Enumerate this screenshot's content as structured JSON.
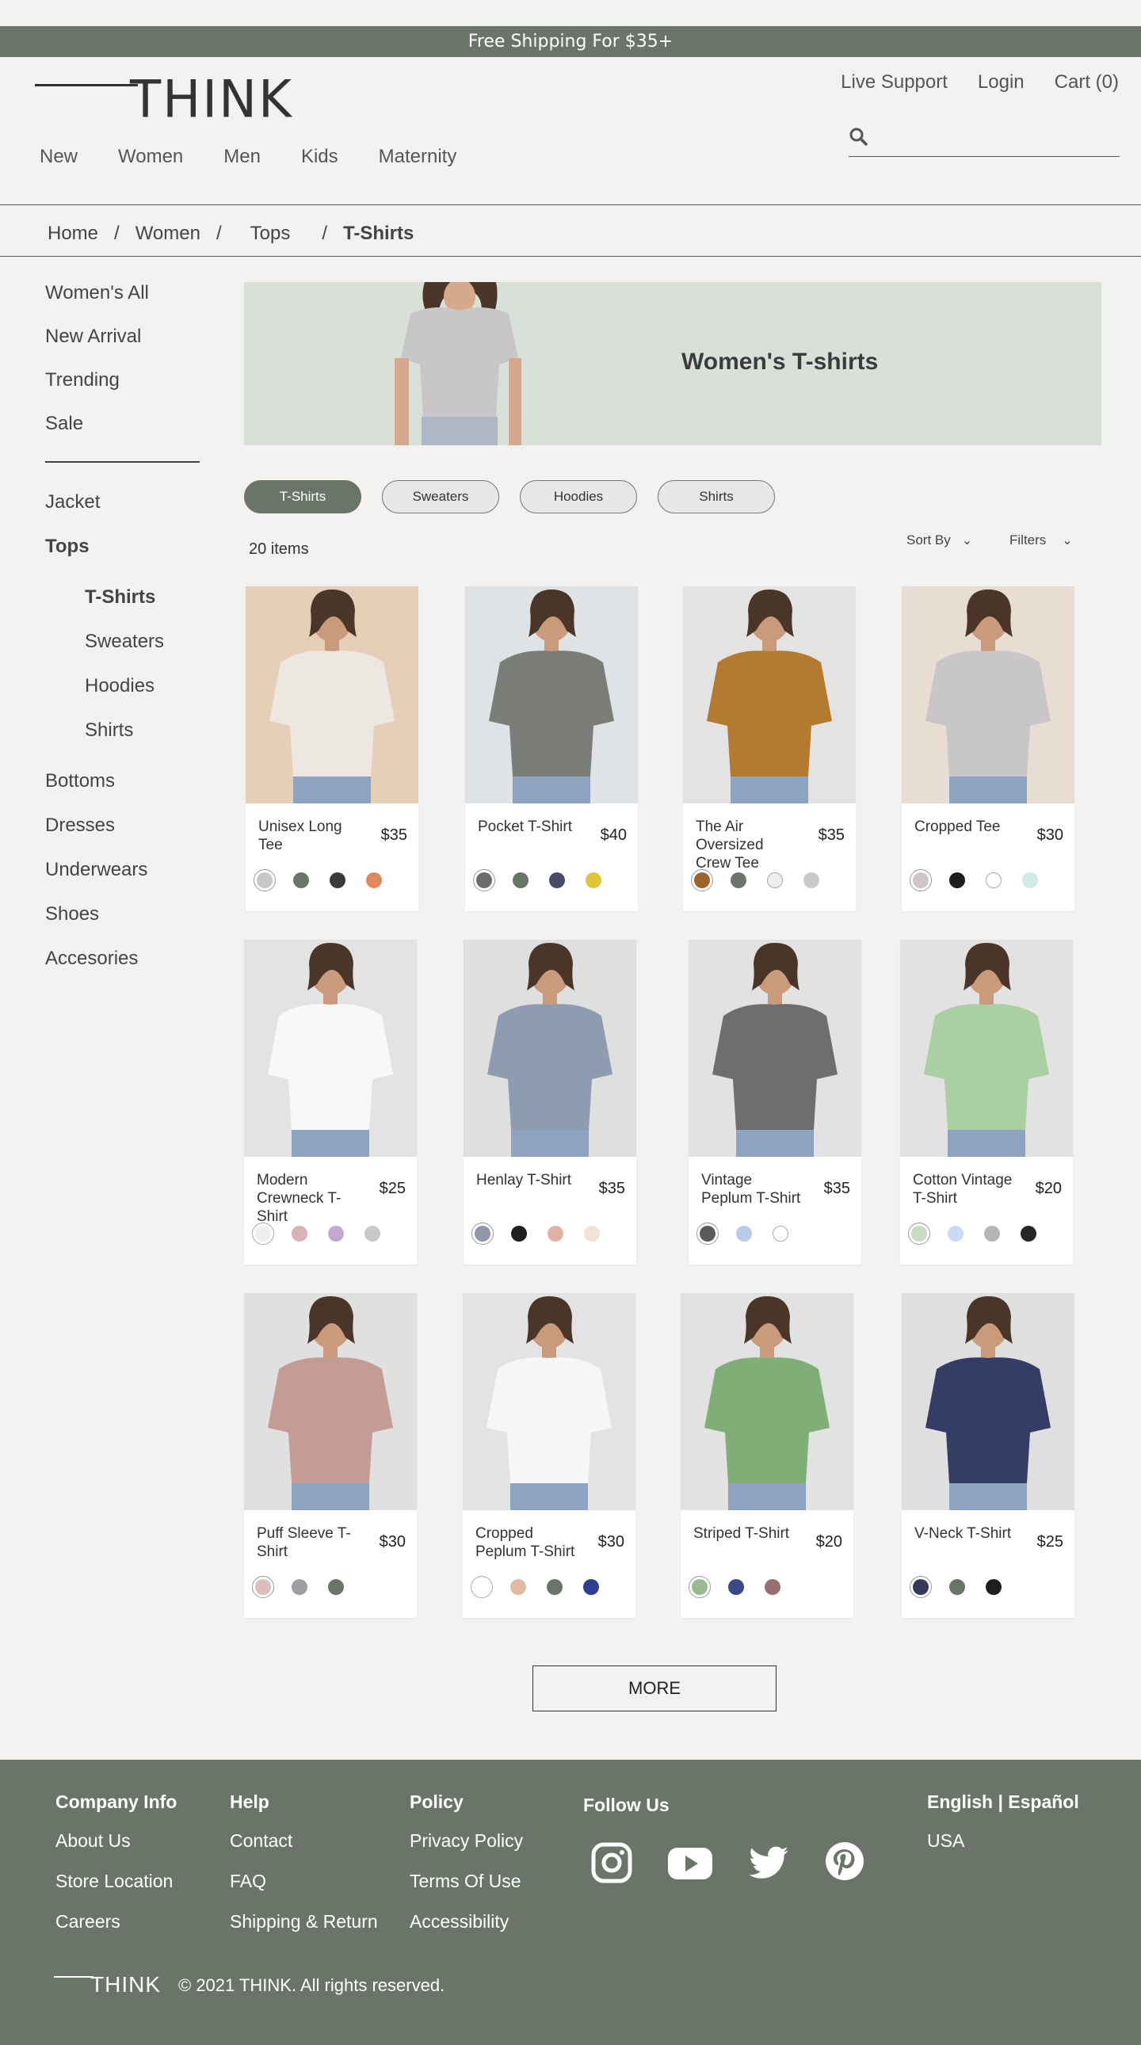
{
  "promo": "Free Shipping For $35+",
  "brand": "THINK",
  "nav": [
    "New",
    "Women",
    "Men",
    "Kids",
    "Maternity"
  ],
  "utility": [
    "Live Support",
    "Login",
    "Cart (0)"
  ],
  "search": {
    "placeholder": "",
    "icon": "search-icon"
  },
  "breadcrumb": [
    "Home",
    "Women",
    "Tops",
    "T-Shirts"
  ],
  "sidebar": {
    "top": [
      "Women's All",
      "New Arrival",
      "Trending",
      "Sale"
    ],
    "categories": [
      "Jacket",
      "Tops"
    ],
    "tops_sub": [
      "T-Shirts",
      "Sweaters",
      "Hoodies",
      "Shirts"
    ],
    "more": [
      "Bottoms",
      "Dresses",
      "Underwears",
      "Shoes",
      "Accesories"
    ]
  },
  "banner_title": "Women's T-shirts",
  "chips": [
    "T-Shirts",
    "Sweaters",
    "Hoodies",
    "Shirts"
  ],
  "item_count": "20 items",
  "sort_label": "Sort By",
  "filters_label": "Filters",
  "products": [
    {
      "name": "Unisex Long Tee",
      "price": "$35",
      "swatches": [
        "#c7c7c7",
        "#6a7468",
        "#3a3a3a",
        "#e08a5c"
      ],
      "bg": "#e6cfb8",
      "shirt": "#ece8e1"
    },
    {
      "name": "Pocket T-Shirt",
      "price": "$40",
      "swatches": [
        "#6c6c6c",
        "#6a7468",
        "#4a4a6a",
        "#e0c43a"
      ],
      "bg": "#dfe3e6",
      "shirt": "#7b7d78"
    },
    {
      "name": "The Air Oversized Crew Tee",
      "price": "$35",
      "swatches": [
        "#a0622a",
        "#6a7468",
        "#eeeeee",
        "#c9c9c9"
      ],
      "bg": "#e4e3e2",
      "shirt": "#b47a30"
    },
    {
      "name": "Cropped Tee",
      "price": "$30",
      "swatches": [
        "#d3c5c7",
        "#1e1e1e",
        "#ffffff",
        "#cfe9e8"
      ],
      "bg": "#e8ddd2",
      "shirt": "#c8c6c8"
    },
    {
      "name": "Modern Crewneck T-Shirt",
      "price": "$25",
      "swatches": [
        "#efefef",
        "#d8b2b5",
        "#c3a9cf",
        "#c9c9c9"
      ],
      "bg": "#e3e3e3",
      "shirt": "#f8f8f8"
    },
    {
      "name": "Henlay T-Shirt",
      "price": "$35",
      "swatches": [
        "#8f97a6",
        "#1e1e1e",
        "#dfb2a4",
        "#f1e4d6"
      ],
      "bg": "#dfdfdf",
      "shirt": "#8e9cb0"
    },
    {
      "name": "Vintage Peplum T-Shirt",
      "price": "$35",
      "swatches": [
        "#5a5a5a",
        "#b9cbe9",
        "#ffffff"
      ],
      "bg": "#e2e2e2",
      "shirt": "#6e6e6e"
    },
    {
      "name": "Cotton Vintage T-Shirt",
      "price": "$20",
      "swatches": [
        "#c6dcc0",
        "#c9dbf2",
        "#b5b5b5",
        "#262626"
      ],
      "bg": "#e2e2e2",
      "shirt": "#a9cfa3"
    },
    {
      "name": "Puff Sleeve T-Shirt",
      "price": "$30",
      "swatches": [
        "#ddbebe",
        "#9d9fa3",
        "#6a7468"
      ],
      "bg": "#e0e0e0",
      "shirt": "#c49c96"
    },
    {
      "name": "Cropped Peplum T-Shirt",
      "price": "$30",
      "swatches": [
        "#ffffff",
        "#e1bba1",
        "#6a7468",
        "#2e3f8f"
      ],
      "bg": "#e3e3e3",
      "shirt": "#f6f6f6"
    },
    {
      "name": "Striped T-Shirt",
      "price": "$20",
      "swatches": [
        "#9bb894",
        "#3b4887",
        "#967070"
      ],
      "bg": "#e2e2e2",
      "shirt": "#7fae77"
    },
    {
      "name": "V-Neck T-Shirt",
      "price": "$25",
      "swatches": [
        "#36395a",
        "#6a7468",
        "#1e1e1e"
      ],
      "bg": "#dfdfdf",
      "shirt": "#353d66"
    }
  ],
  "more_label": "MORE",
  "footer": {
    "company": {
      "heading": "Company Info",
      "links": [
        "About Us",
        "Store Location",
        "Careers"
      ]
    },
    "help": {
      "heading": "Help",
      "links": [
        "Contact",
        "FAQ",
        "Shipping & Return"
      ]
    },
    "policy": {
      "heading": "Policy",
      "links": [
        "Privacy Policy",
        "Terms Of Use",
        "Accessibility"
      ]
    },
    "follow": "Follow Us",
    "social": [
      "instagram-icon",
      "youtube-icon",
      "twitter-icon",
      "pinterest-icon"
    ],
    "language": "English | Español",
    "country": "USA",
    "brand": "THINK",
    "copyright": "© 2021 THINK. All rights reserved."
  },
  "colors": {
    "accent": "#6a7468",
    "background": "#f3f2f0",
    "banner": "#d9e0da"
  }
}
